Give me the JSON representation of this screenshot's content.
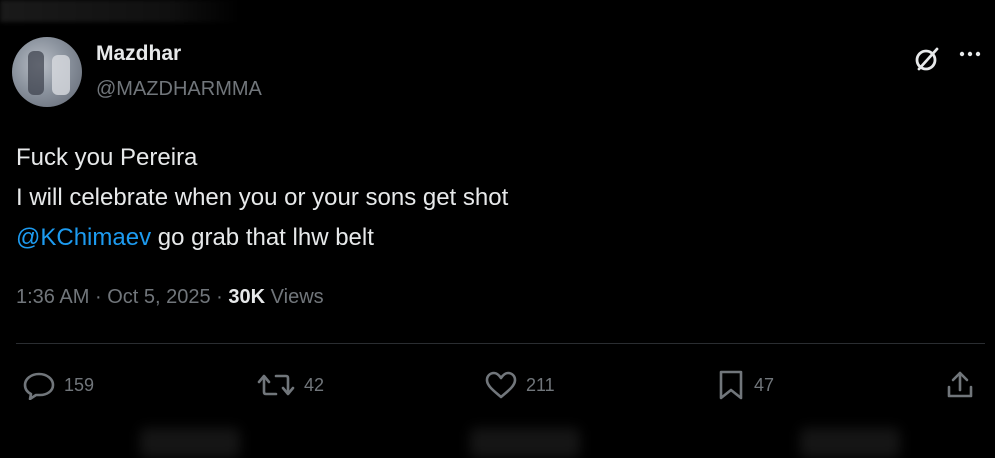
{
  "tweet": {
    "author": {
      "display_name": "Mazdhar",
      "handle": "@MAZDHARMMA"
    },
    "text_lines": [
      "Fuck you Pereira",
      "I will celebrate when you or your sons get shot"
    ],
    "mention": "@KChimaev",
    "mention_rest": " go grab that lhw belt",
    "time": "1:36 AM",
    "separator": "·",
    "date": "Oct 5, 2025",
    "views_count": "30K",
    "views_label": " Views"
  },
  "actions": {
    "replies": "159",
    "reposts": "42",
    "likes": "211",
    "bookmarks": "47"
  },
  "icons": {
    "header": [
      "grok-icon",
      "more-icon"
    ],
    "actions": [
      "reply-icon",
      "repost-icon",
      "like-icon",
      "bookmark-icon",
      "share-icon"
    ]
  },
  "colors": {
    "background": "#000000",
    "text": "#e7e9ea",
    "secondary": "#71767b",
    "link": "#1d9bf0"
  }
}
